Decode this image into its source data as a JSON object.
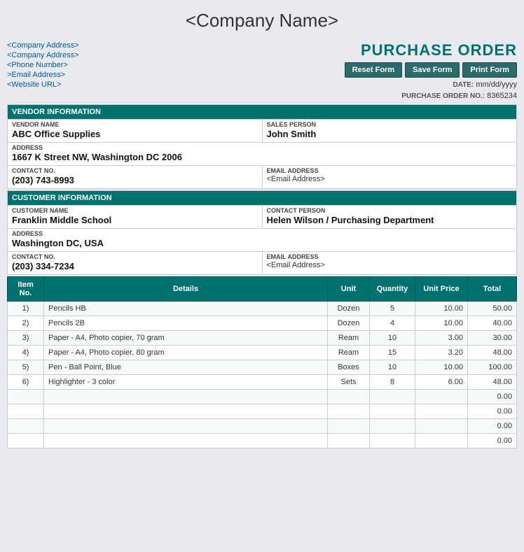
{
  "header": {
    "company_name": "<Company Name>",
    "po_title": "PURCHASE ORDER",
    "buttons": {
      "reset": "Reset Form",
      "save": "Save Form",
      "print": "Print Form"
    },
    "date_label": "DATE:",
    "date_value": "mm/dd/yyyy",
    "po_label": "PURCHASE ORDER NO.:",
    "po_number": "8365234"
  },
  "company_info": {
    "address1": "<Company Address>",
    "address2": "<Company Address>",
    "phone": "<Phone Number>",
    "email": ">Email Address>",
    "website": "<Website URL>"
  },
  "vendor": {
    "section_title": "VENDOR INFORMATION",
    "name_label": "VENDOR NAME",
    "name_value": "ABC Office Supplies",
    "sales_label": "SALES PERSON",
    "sales_value": "John Smith",
    "address_label": "ADDRESS",
    "address_value": "1667 K Street NW, Washington DC  2006",
    "contact_label": "CONTACT NO.",
    "contact_value": "(203) 743-8993",
    "email_label": "EMAIL ADDRESS",
    "email_value": "<Email Address>"
  },
  "customer": {
    "section_title": "CUSTOMER INFORMATION",
    "name_label": "CUSTOMER NAME",
    "name_value": "Franklin Middle School",
    "contact_person_label": "CONTACT PERSON",
    "contact_person_value": "Helen Wilson / Purchasing Department",
    "address_label": "ADDRESS",
    "address_value": "Washington DC, USA",
    "contact_label": "CONTACT NO.",
    "contact_value": "(203) 334-7234",
    "email_label": "EMAIL ADDRESS",
    "email_value": "<Email Address>"
  },
  "items_table": {
    "headers": [
      "Item No.",
      "Details",
      "Unit",
      "Quantity",
      "Unit Price",
      "Total"
    ],
    "rows": [
      {
        "item_no": "1)",
        "details": "Pencils HB",
        "unit": "Dozen",
        "quantity": "5",
        "unit_price": "10.00",
        "total": "50.00"
      },
      {
        "item_no": "2)",
        "details": "Pencils 2B",
        "unit": "Dozen",
        "quantity": "4",
        "unit_price": "10.00",
        "total": "40.00"
      },
      {
        "item_no": "3)",
        "details": "Paper - A4, Photo copier, 70 gram",
        "unit": "Ream",
        "quantity": "10",
        "unit_price": "3.00",
        "total": "30.00"
      },
      {
        "item_no": "4)",
        "details": "Paper - A4, Photo copier, 80 gram",
        "unit": "Ream",
        "quantity": "15",
        "unit_price": "3.20",
        "total": "48.00"
      },
      {
        "item_no": "5)",
        "details": "Pen - Ball Point, Blue",
        "unit": "Boxes",
        "quantity": "10",
        "unit_price": "10.00",
        "total": "100.00"
      },
      {
        "item_no": "6)",
        "details": "Highlighter - 3 color",
        "unit": "Sets",
        "quantity": "8",
        "unit_price": "6.00",
        "total": "48.00"
      },
      {
        "item_no": "",
        "details": "",
        "unit": "",
        "quantity": "",
        "unit_price": "",
        "total": "0.00"
      },
      {
        "item_no": "",
        "details": "",
        "unit": "",
        "quantity": "",
        "unit_price": "",
        "total": "0.00"
      },
      {
        "item_no": "",
        "details": "",
        "unit": "",
        "quantity": "",
        "unit_price": "",
        "total": "0.00"
      },
      {
        "item_no": "",
        "details": "",
        "unit": "",
        "quantity": "",
        "unit_price": "",
        "total": "0.00"
      }
    ]
  }
}
